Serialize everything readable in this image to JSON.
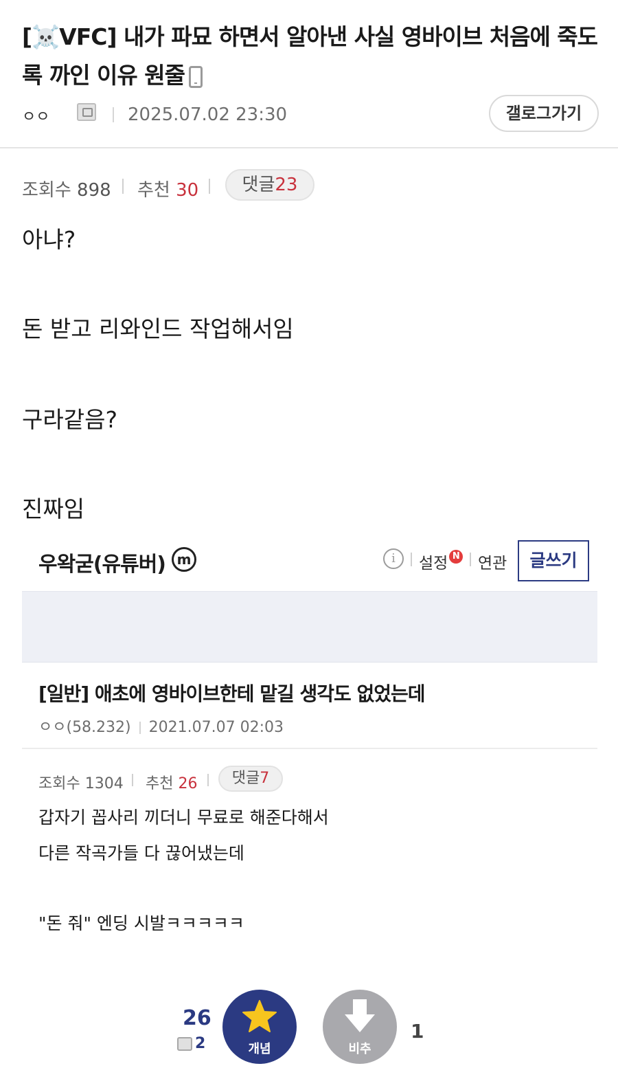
{
  "post": {
    "title": "[☠️VFC] 내가 파묘 하면서 알아낸 사실 영바이브 처음에 죽도록 까인 이유 원줄",
    "author": "ㅇㅇ",
    "date": "2025.07.02 23:30",
    "gallery_button": "갤로그가기",
    "views_label": "조회수",
    "views": "898",
    "recommend_label": "추천",
    "recommend": "30",
    "comments_label": "댓글",
    "comments": "23",
    "body": [
      "아냐?",
      "돈 받고 리와인드 작업해서임",
      "구라같음?",
      "진짜임"
    ]
  },
  "embed": {
    "gallery_name": "우왁굳(유튜버)",
    "m_badge": "m",
    "info_icon": "i",
    "settings_label": "설정",
    "settings_badge": "N",
    "related_label": "연관",
    "write_button": "글쓰기",
    "post_title": "[일반] 애초에 영바이브한테 맡길 생각도 없었는데",
    "author": "ㅇㅇ(58.232)",
    "date": "2021.07.07 02:03",
    "views_label": "조회수",
    "views": "1304",
    "recommend_label": "추천",
    "recommend": "26",
    "comments_label": "댓글",
    "comments": "7",
    "body": [
      "갑자기 꼽사리 끼더니 무료로 해준다해서",
      "다른 작곡가들 다 끊어냈는데",
      "\"돈 줘\" 엔딩 시발ㅋㅋㅋㅋㅋ"
    ]
  },
  "votes": {
    "up_count": "26",
    "fix_count": "2",
    "up_label": "개념",
    "down_label": "비추",
    "down_count": "1"
  },
  "colors": {
    "accent_navy": "#2b3a82",
    "count_red": "#c8313c",
    "down_gray": "#a9a9ad"
  },
  "icons": {
    "phone": "phone-icon",
    "gallog": "gallog-icon",
    "star": "star-icon",
    "arrow_down": "arrow-down-icon",
    "info": "info-icon"
  }
}
